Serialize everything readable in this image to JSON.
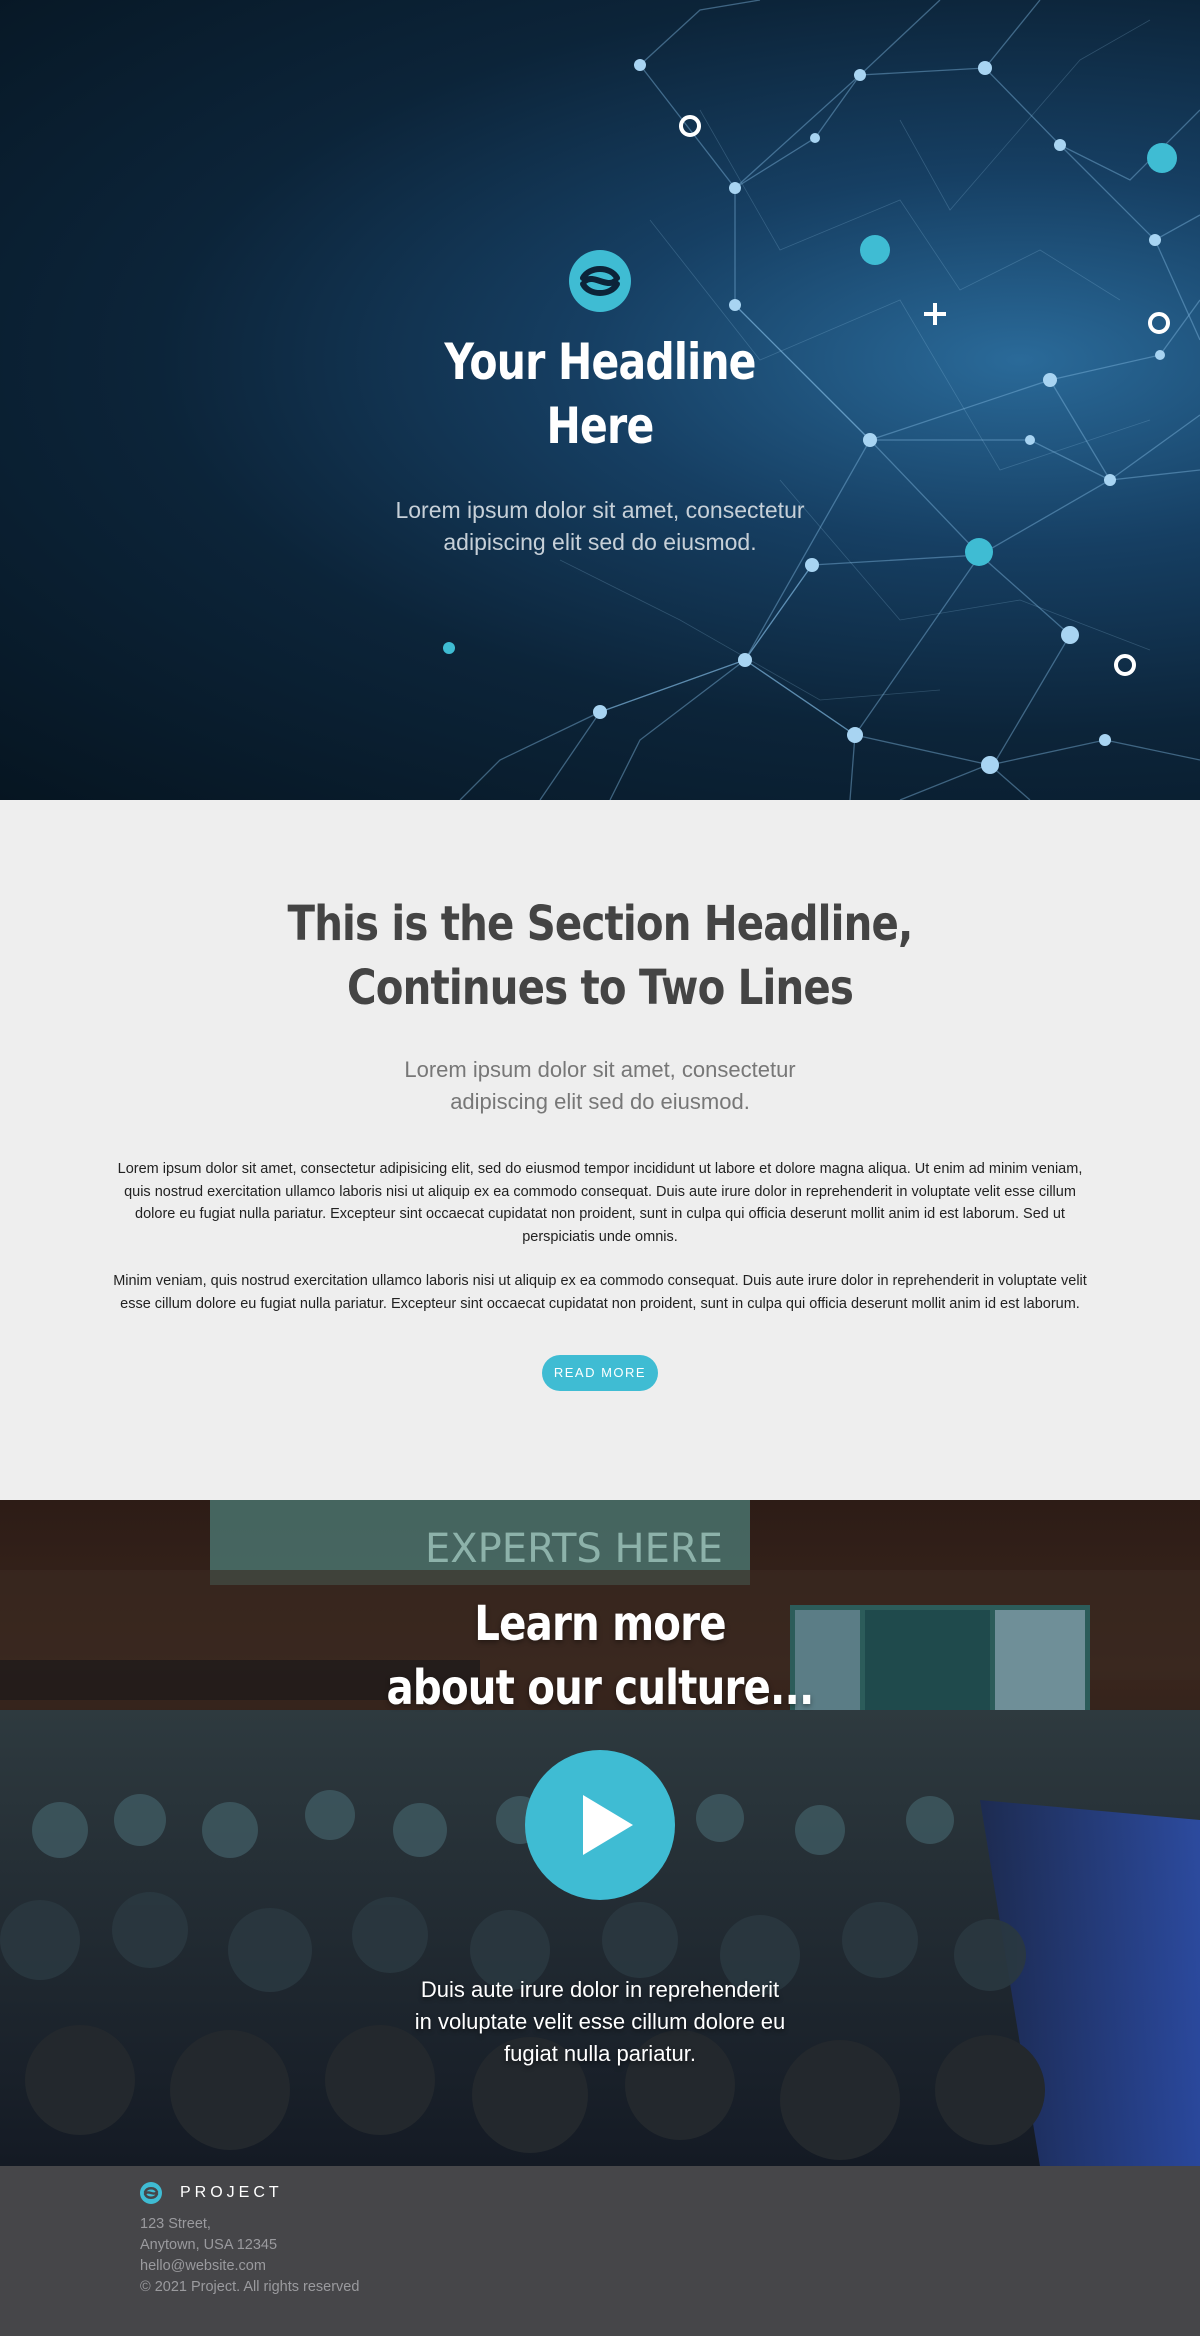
{
  "hero": {
    "title_lines": [
      "Your Headline",
      "Here"
    ],
    "subtitle_lines": [
      "Lorem ipsum dolor sit amet, consectetur",
      "adipiscing elit sed do eiusmod."
    ]
  },
  "section": {
    "title_lines": [
      "This is the Section Headline,",
      "Continues to Two Lines"
    ],
    "subtitle_lines": [
      "Lorem ipsum dolor sit amet, consectetur",
      "adipiscing elit sed do eiusmod."
    ],
    "paragraphs": [
      "Lorem ipsum dolor sit amet, consectetur adipisicing elit, sed do eiusmod tempor incididunt ut labore et dolore magna aliqua. Ut enim ad minim veniam, quis nostrud exercitation ullamco laboris nisi ut aliquip ex ea commodo consequat. Duis aute irure dolor in reprehenderit in voluptate velit esse cillum dolore eu fugiat nulla pariatur. Excepteur sint occaecat cupidatat non proident, sunt in culpa qui officia deserunt mollit anim id est laborum. Sed ut perspiciatis unde omnis.",
      "Minim veniam, quis nostrud exercitation ullamco laboris nisi ut aliquip ex ea commodo consequat. Duis aute irure dolor in reprehenderit in voluptate velit esse cillum dolore eu fugiat nulla pariatur. Excepteur sint occaecat cupidatat non proident, sunt in culpa qui officia deserunt mollit anim id est laborum."
    ],
    "button_label": "READ MORE"
  },
  "video": {
    "title_lines": [
      "Learn more",
      "about our culture..."
    ],
    "subtitle_lines": [
      "Duis aute irure dolor in reprehenderit",
      "in voluptate velit esse cillum dolore eu",
      "fugiat nulla pariatur."
    ],
    "play_icon": "play-icon",
    "banner_text": "EXPERTS HERE"
  },
  "footer": {
    "brand": "PROJECT",
    "address_lines": [
      "123 Street,",
      "Anytown, USA 12345",
      "hello@website.com",
      "© 2021 Project. All rights reserved"
    ]
  },
  "colors": {
    "accent": "#3fbcd3",
    "hero_bg": "#0c2439",
    "section_bg": "#eeeeee",
    "footer_bg": "#464649",
    "heading_dark": "#444444"
  }
}
